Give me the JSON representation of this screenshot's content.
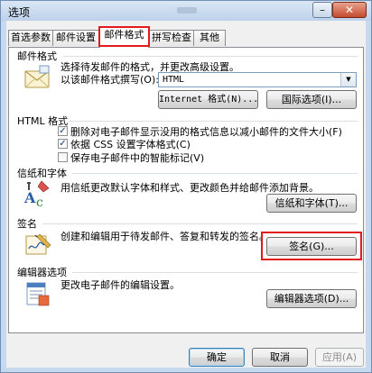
{
  "window": {
    "title": "选项",
    "min_glyph": "–",
    "close_glyph": "✕"
  },
  "tabs": [
    {
      "label": "首选参数"
    },
    {
      "label": "邮件设置"
    },
    {
      "label": "邮件格式"
    },
    {
      "label": "拼写检查"
    },
    {
      "label": "其他"
    }
  ],
  "mail_format": {
    "title": "邮件格式",
    "description": "选择待发邮件的格式，并更改高级设置。",
    "compose_label": "以该邮件格式撰写(O):",
    "compose_value": "HTML",
    "internet_format_button": "Internet 格式(N)...",
    "international_options_button": "国际选项(I)..."
  },
  "html_format": {
    "title": "HTML 格式",
    "options": [
      {
        "label": "删除对电子邮件显示没用的格式信息以减小邮件的文件大小(F)",
        "checked": true
      },
      {
        "label": "依据 CSS 设置字体格式(C)",
        "checked": true
      },
      {
        "label": "保存电子邮件中的智能标记(V)",
        "checked": false
      }
    ]
  },
  "stationery": {
    "title": "信纸和字体",
    "description": "用信纸更改默认字体和样式、更改颜色并给邮件添加背景。",
    "button": "信纸和字体(T)..."
  },
  "signatures": {
    "title": "签名",
    "description": "创建和编辑用于待发邮件、答复和转发的签名。",
    "button": "签名(G)..."
  },
  "editor": {
    "title": "编辑器选项",
    "description": "更改电子邮件的编辑设置。",
    "button": "编辑器选项(D)..."
  },
  "footer": {
    "ok": "确定",
    "cancel": "取消",
    "apply": "应用(A)"
  }
}
